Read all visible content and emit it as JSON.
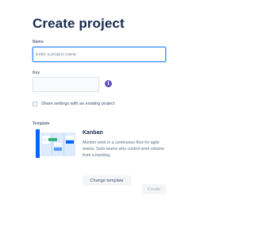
{
  "page": {
    "title": "Create project"
  },
  "name_field": {
    "label": "Name",
    "placeholder": "Enter a project name",
    "value": ""
  },
  "key_field": {
    "label": "Key",
    "value": "",
    "info_icon": "info-icon"
  },
  "share_settings": {
    "label": "Share settings with an existing project",
    "checked": false
  },
  "template": {
    "section_label": "Template",
    "name": "Kanban",
    "description": "Monitor work in a continuous flow for agile teams. Suits teams who control work volume from a backlog.",
    "change_label": "Change template"
  },
  "actions": {
    "create_label": "Create"
  },
  "colors": {
    "accent": "#4C9AFF",
    "info": "#6554C0",
    "text": "#172B4D",
    "template_blue": "#0065FF",
    "template_green": "#36B37E"
  }
}
